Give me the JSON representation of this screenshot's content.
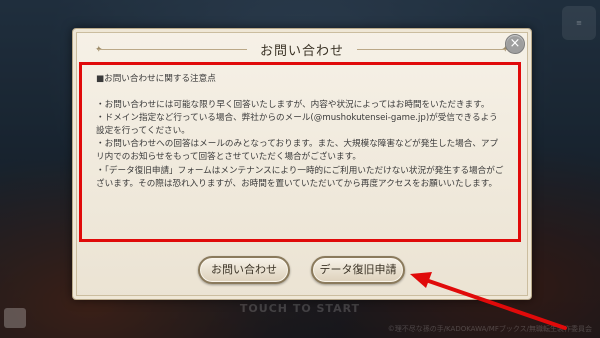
{
  "background": {
    "touch_text": "TOUCH TO START",
    "copyright": "©理不尽な孫の手/KADOKAWA/MFブックス/無職転生製作委員会"
  },
  "dialog": {
    "title": "お問い合わせ",
    "content": {
      "heading": "■お問い合わせに関する注意点",
      "paragraphs": [
        "・お問い合わせには可能な限り早く回答いたしますが、内容や状況によってはお時間をいただきます。",
        "・ドメイン指定など行っている場合、弊社からのメール(@mushokutensei-game.jp)が受信できるよう設定を行ってください。",
        "・お問い合わせへの回答はメールのみとなっております。また、大規模な障害などが発生した場合、アプリ内でのお知らせをもって回答とさせていただく場合がございます。",
        "・「データ復旧申請」フォームはメンテナンスにより一時的にご利用いただけない状況が発生する場合がございます。その際は恐れ入りますが、お時間を置いていただいてから再度アクセスをお願いいたします。"
      ]
    },
    "buttons": {
      "inquiry": "お問い合わせ",
      "data_recovery": "データ復旧申請"
    }
  },
  "colors": {
    "highlight": "#e00a0a",
    "panel": "#f6f1e7"
  },
  "icons": {
    "close": "close-icon",
    "annotation": "arrow-icon"
  }
}
